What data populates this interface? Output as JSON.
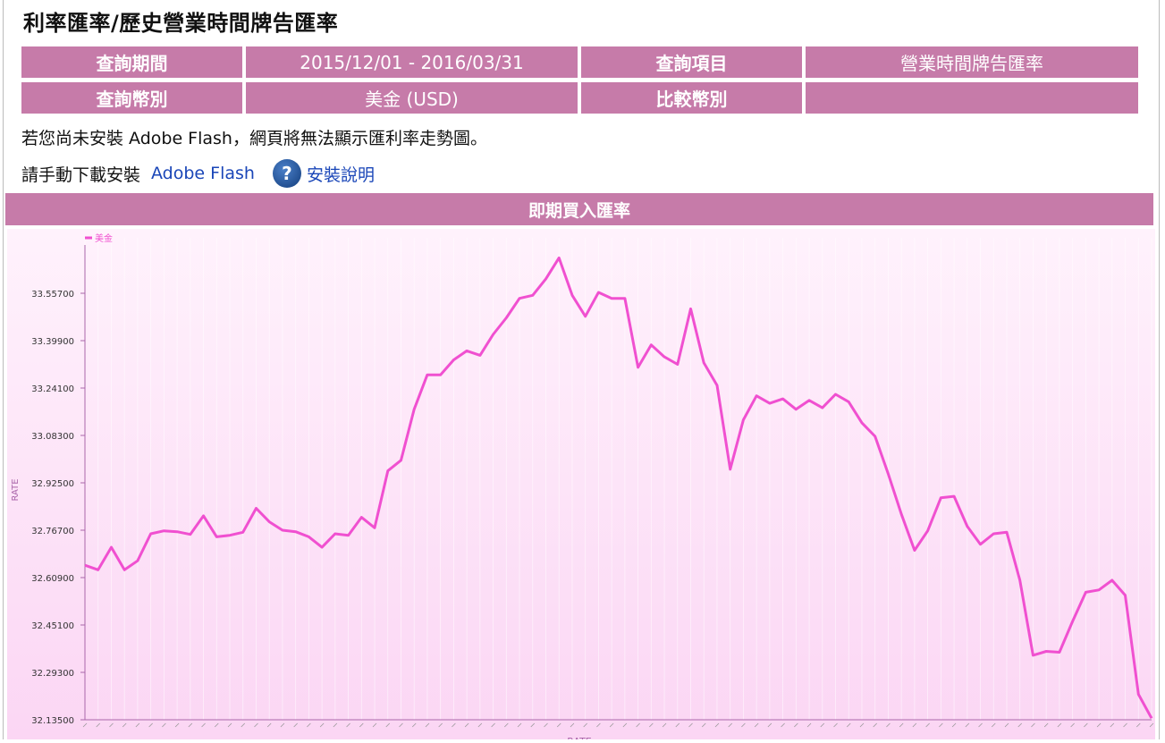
{
  "page": {
    "title": "利率匯率/歷史營業時間牌告匯率"
  },
  "query": {
    "period_label": "查詢期間",
    "period_value": "2015/12/01 - 2016/03/31",
    "item_label": "查詢項目",
    "item_value": "營業時間牌告匯率",
    "currency_label": "查詢幣別",
    "currency_value": "美金 (USD)",
    "compare_label": "比較幣別",
    "compare_value": ""
  },
  "notice": {
    "flash_warning": "若您尚未安裝 Adobe Flash，網頁將無法顯示匯利率走勢圖。",
    "install_prefix": "請手動下載安裝",
    "flash_link": "Adobe Flash",
    "help_link": "安裝說明"
  },
  "chart_title": "即期買入匯率",
  "colors": {
    "header_bg": "#c67ba9",
    "line": "#f050d0",
    "axis": "#aa66aa",
    "link": "#1a46b8"
  },
  "chart_data": {
    "type": "line",
    "ylabel": "RATE",
    "xlabel": "RATE",
    "legend": "top-left",
    "ylim": [
      32.135,
      33.735
    ],
    "yticks": [
      "33.55700",
      "33.39900",
      "33.24100",
      "33.08300",
      "32.92500",
      "32.76700",
      "32.60900",
      "32.45100",
      "32.29300",
      "32.13500"
    ],
    "series": [
      {
        "name": "美金",
        "values": [
          32.65,
          32.635,
          32.71,
          32.635,
          32.665,
          32.755,
          32.765,
          32.762,
          32.753,
          32.815,
          32.745,
          32.75,
          32.76,
          32.84,
          32.795,
          32.767,
          32.762,
          32.745,
          32.71,
          32.755,
          32.75,
          32.81,
          32.775,
          32.965,
          33.0,
          33.17,
          33.285,
          33.285,
          33.335,
          33.365,
          33.35,
          33.42,
          33.475,
          33.54,
          33.55,
          33.605,
          33.675,
          33.55,
          33.48,
          33.56,
          33.54,
          33.54,
          33.31,
          33.385,
          33.345,
          33.32,
          33.505,
          33.325,
          33.25,
          32.97,
          33.135,
          33.215,
          33.19,
          33.205,
          33.17,
          33.2,
          33.175,
          33.22,
          33.195,
          33.125,
          33.08,
          32.955,
          32.82,
          32.7,
          32.765,
          32.875,
          32.88,
          32.78,
          32.72,
          32.755,
          32.76,
          32.6,
          32.35,
          32.363,
          32.36,
          32.463,
          32.56,
          32.568,
          32.6,
          32.55,
          32.22,
          32.14
        ]
      }
    ]
  }
}
